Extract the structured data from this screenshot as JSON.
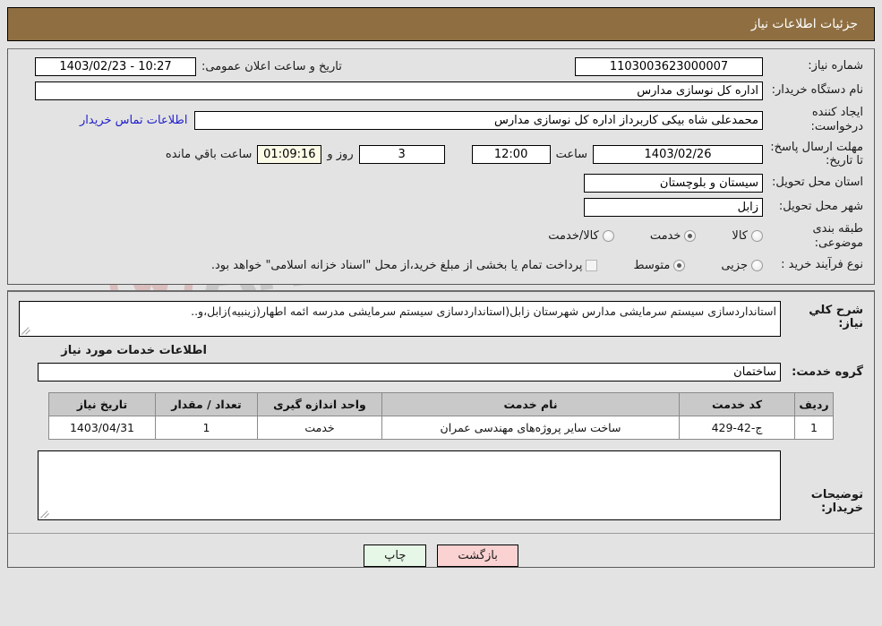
{
  "header": {
    "title": "جزئیات اطلاعات نیاز",
    "bg_color": "#8f6f42"
  },
  "form": {
    "need_number": {
      "label": "شماره نیاز:",
      "value": "1103003623000007"
    },
    "announce_datetime": {
      "label": "تاریخ و ساعت اعلان عمومی:",
      "value": "10:27 - 1403/02/23"
    },
    "buyer_org": {
      "label": "نام دستگاه خریدار:",
      "value": "اداره کل نوسازی مدارس"
    },
    "request_creator": {
      "label": "ایجاد کننده درخواست:",
      "value": "محمدعلی شاه بیکی کاربرداز اداره کل نوسازی مدارس"
    },
    "buyer_contact_link": "اطلاعات تماس خریدار",
    "deadline": {
      "label": "مهلت ارسال پاسخ: تا تاریخ:",
      "date": "1403/02/26",
      "time_label": "ساعت",
      "time": "12:00",
      "days": "3",
      "days_label": "روز و",
      "countdown": "01:09:16",
      "countdown_label": "ساعت باقي مانده"
    },
    "province": {
      "label": "استان محل تحویل:",
      "value": "سیستان و بلوچستان"
    },
    "city": {
      "label": "شهر محل تحویل:",
      "value": "زابل"
    },
    "category": {
      "label": "طبقه بندی موضوعی:",
      "options": [
        {
          "label": "کالا",
          "selected": false
        },
        {
          "label": "خدمت",
          "selected": true
        },
        {
          "label": "کالا/خدمت",
          "selected": false
        }
      ]
    },
    "process_type": {
      "label": "نوع فرآیند خرید :",
      "options": [
        {
          "label": "جزیی",
          "selected": false
        },
        {
          "label": "متوسط",
          "selected": true
        }
      ],
      "checkbox_label": "پرداخت تمام یا بخشی از مبلغ خرید،از محل \"اسناد خزانه اسلامی\" خواهد بود.",
      "checkbox_checked": false
    }
  },
  "details": {
    "general_desc": {
      "label": "شرح کلي نیاز:",
      "value": "استانداردسازی سیستم سرمایشی مدارس شهرستان زابل(استانداردسازی سیستم سرمایشی مدرسه ائمه اطهار(زینبیه)زابل،و.."
    },
    "services_heading": "اطلاعات خدمات مورد نیاز",
    "service_group": {
      "label": "گروه خدمت:",
      "value": "ساختمان"
    },
    "table": {
      "columns": [
        "ردیف",
        "کد خدمت",
        "نام خدمت",
        "واحد اندازه گیری",
        "تعداد / مقدار",
        "تاریخ نیاز"
      ],
      "rows": [
        {
          "row_no": "1",
          "service_code": "ج-42-429",
          "service_name": "ساخت سایر پروژه‌های مهندسی عمران",
          "unit": "خدمت",
          "quantity": "1",
          "need_date": "1403/04/31"
        }
      ]
    },
    "buyer_comments": {
      "label": "توضیحات خریدار:",
      "value": ""
    }
  },
  "footer": {
    "print_label": "چاپ",
    "back_label": "بازگشت"
  },
  "watermark": {
    "text": "AriaTender.net"
  }
}
